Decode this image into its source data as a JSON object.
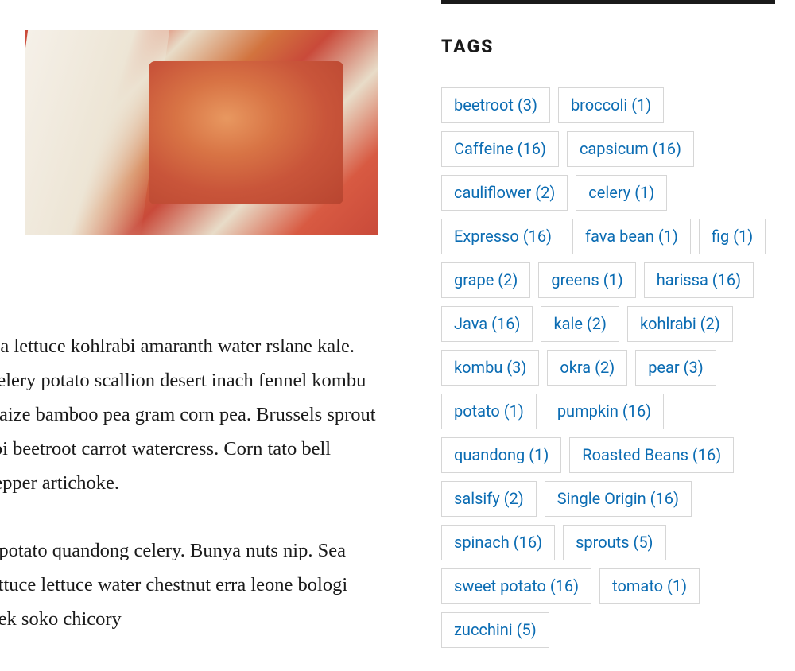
{
  "main": {
    "paragraph1": " sea lettuce kohlrabi amaranth water rslane kale. Celery potato scallion desert inach fennel kombu maize bamboo pea gram corn pea. Brussels sprout abi beetroot carrot watercress. Corn tato bell pepper artichoke.",
    "paragraph2": "n potato quandong celery. Bunya nuts nip. Sea lettuce lettuce water chestnut erra leone bologi leek soko chicory"
  },
  "sidebar": {
    "heading": "TAGS",
    "tags": [
      {
        "label": "beetroot",
        "count": 3
      },
      {
        "label": "broccoli",
        "count": 1
      },
      {
        "label": "Caffeine",
        "count": 16
      },
      {
        "label": "capsicum",
        "count": 16
      },
      {
        "label": "cauliflower",
        "count": 2
      },
      {
        "label": "celery",
        "count": 1
      },
      {
        "label": "Expresso",
        "count": 16
      },
      {
        "label": "fava bean",
        "count": 1
      },
      {
        "label": "fig",
        "count": 1
      },
      {
        "label": "grape",
        "count": 2
      },
      {
        "label": "greens",
        "count": 1
      },
      {
        "label": "harissa",
        "count": 16
      },
      {
        "label": "Java",
        "count": 16
      },
      {
        "label": "kale",
        "count": 2
      },
      {
        "label": "kohlrabi",
        "count": 2
      },
      {
        "label": "kombu",
        "count": 3
      },
      {
        "label": "okra",
        "count": 2
      },
      {
        "label": "pear",
        "count": 3
      },
      {
        "label": "potato",
        "count": 1
      },
      {
        "label": "pumpkin",
        "count": 16
      },
      {
        "label": "quandong",
        "count": 1
      },
      {
        "label": "Roasted Beans",
        "count": 16
      },
      {
        "label": "salsify",
        "count": 2
      },
      {
        "label": "Single Origin",
        "count": 16
      },
      {
        "label": "spinach",
        "count": 16
      },
      {
        "label": "sprouts",
        "count": 5
      },
      {
        "label": "sweet potato",
        "count": 16
      },
      {
        "label": "tomato",
        "count": 1
      },
      {
        "label": "zucchini",
        "count": 5
      }
    ]
  }
}
